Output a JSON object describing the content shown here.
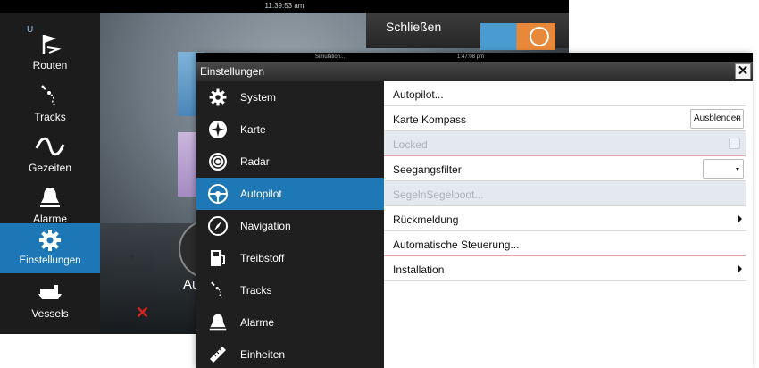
{
  "background_app": {
    "status_time": "11:39:53 am",
    "close_label": "Schließen",
    "partial_label": "Au",
    "sidebar_top_label": "U",
    "sidebar": [
      {
        "label": "Routen",
        "icon": "routes-flag-icon",
        "active": false
      },
      {
        "label": "Tracks",
        "icon": "tracks-icon",
        "active": false
      },
      {
        "label": "Gezeiten",
        "icon": "tides-wave-icon",
        "active": false
      },
      {
        "label": "Alarme",
        "icon": "bell-icon",
        "active": false
      },
      {
        "label": "Einstellungen",
        "icon": "gear-icon",
        "active": true
      },
      {
        "label": "Vessels",
        "icon": "vessels-ship-icon",
        "active": false
      }
    ]
  },
  "dialog": {
    "status_sim": "Simulation...",
    "status_time": "1:47:08 pm",
    "title": "Einstellungen",
    "menu": [
      {
        "label": "System",
        "icon": "gear-icon",
        "active": false
      },
      {
        "label": "Karte",
        "icon": "chart-compass-icon",
        "active": false
      },
      {
        "label": "Radar",
        "icon": "radar-icon",
        "active": false
      },
      {
        "label": "Autopilot",
        "icon": "steering-wheel-icon",
        "active": true
      },
      {
        "label": "Navigation",
        "icon": "navigation-compass-icon",
        "active": false
      },
      {
        "label": "Treibstoff",
        "icon": "fuel-pump-icon",
        "active": false
      },
      {
        "label": "Tracks",
        "icon": "tracks-icon",
        "active": false
      },
      {
        "label": "Alarme",
        "icon": "bell-icon",
        "active": false
      },
      {
        "label": "Einheiten",
        "icon": "ruler-icon",
        "active": false
      }
    ],
    "settings": [
      {
        "label": "Autopilot..."
      },
      {
        "label": "Karte Kompass",
        "value": "Ausblenden"
      },
      {
        "label": "Locked"
      },
      {
        "label": "Seegangsfilter",
        "value": ""
      },
      {
        "label": "SegelnSegelboot..."
      },
      {
        "label": "Rückmeldung"
      },
      {
        "label": "Automatische Steuerung..."
      },
      {
        "label": "Installation"
      }
    ]
  },
  "colors": {
    "accent_blue": "#1f78b6",
    "sidebar_dark": "#1f1f1f",
    "disabled_row": "#e4e9ef",
    "alert_red": "#d9231f"
  }
}
